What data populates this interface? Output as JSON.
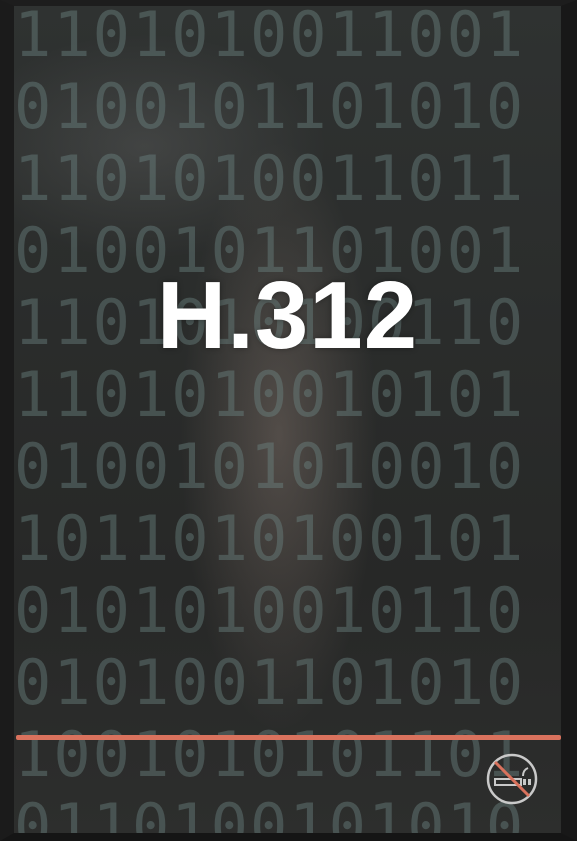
{
  "sign": {
    "room_code": "H.312",
    "accent_line_color": "#d9725d",
    "text_color": "#ffffff"
  },
  "icons": {
    "no_smoking": "no-smoking-icon"
  }
}
